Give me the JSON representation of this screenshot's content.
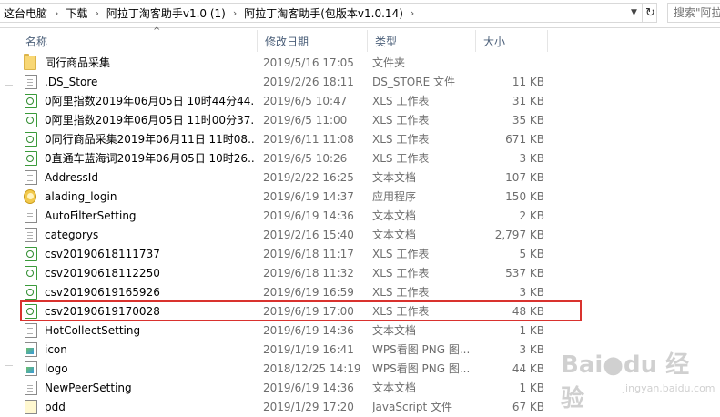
{
  "address": {
    "breadcrumbs": [
      "这台电脑",
      "下载",
      "阿拉丁淘客助手v1.0 (1)",
      "阿拉丁淘客助手(包版本v1.0.14)"
    ],
    "search_placeholder": "搜索\"阿拉丁"
  },
  "columns": {
    "name": "名称",
    "date": "修改日期",
    "type": "类型",
    "size": "大小"
  },
  "files": [
    {
      "name": "同行商品采集",
      "date": "2019/5/16 17:05",
      "type": "文件夹",
      "size": "",
      "icon": "folder-icon"
    },
    {
      "name": ".DS_Store",
      "date": "2019/2/26 18:11",
      "type": "DS_STORE 文件",
      "size": "11 KB",
      "icon": "file-icon"
    },
    {
      "name": "0阿里指数2019年06月05日 10时44分44...",
      "date": "2019/6/5 10:47",
      "type": "XLS 工作表",
      "size": "31 KB",
      "icon": "xls-icon"
    },
    {
      "name": "0阿里指数2019年06月05日 11时00分37...",
      "date": "2019/6/5 11:00",
      "type": "XLS 工作表",
      "size": "35 KB",
      "icon": "xls-icon"
    },
    {
      "name": "0同行商品采集2019年06月11日 11时08...",
      "date": "2019/6/11 11:08",
      "type": "XLS 工作表",
      "size": "671 KB",
      "icon": "xls-icon"
    },
    {
      "name": "0直通车蓝海词2019年06月05日 10时26...",
      "date": "2019/6/5 10:26",
      "type": "XLS 工作表",
      "size": "3 KB",
      "icon": "xls-icon"
    },
    {
      "name": "AddressId",
      "date": "2019/2/22 16:25",
      "type": "文本文档",
      "size": "107 KB",
      "icon": "text-file-icon"
    },
    {
      "name": "alading_login",
      "date": "2019/6/19 14:37",
      "type": "应用程序",
      "size": "150 KB",
      "icon": "app-icon"
    },
    {
      "name": "AutoFilterSetting",
      "date": "2019/6/19 14:36",
      "type": "文本文档",
      "size": "2 KB",
      "icon": "text-file-icon"
    },
    {
      "name": "categorys",
      "date": "2019/2/16 15:40",
      "type": "文本文档",
      "size": "2,797 KB",
      "icon": "text-file-icon"
    },
    {
      "name": "csv20190618111737",
      "date": "2019/6/18 11:17",
      "type": "XLS 工作表",
      "size": "5 KB",
      "icon": "xls-icon"
    },
    {
      "name": "csv20190618112250",
      "date": "2019/6/18 11:32",
      "type": "XLS 工作表",
      "size": "537 KB",
      "icon": "xls-icon"
    },
    {
      "name": "csv20190619165926",
      "date": "2019/6/19 16:59",
      "type": "XLS 工作表",
      "size": "3 KB",
      "icon": "xls-icon"
    },
    {
      "name": "csv20190619170028",
      "date": "2019/6/19 17:00",
      "type": "XLS 工作表",
      "size": "48 KB",
      "icon": "xls-icon"
    },
    {
      "name": "HotCollectSetting",
      "date": "2019/6/19 14:36",
      "type": "文本文档",
      "size": "1 KB",
      "icon": "text-file-icon"
    },
    {
      "name": "icon",
      "date": "2019/1/19 16:41",
      "type": "WPS看图 PNG 图...",
      "size": "3 KB",
      "icon": "png-icon"
    },
    {
      "name": "logo",
      "date": "2018/12/25 14:19",
      "type": "WPS看图 PNG 图...",
      "size": "44 KB",
      "icon": "png-icon"
    },
    {
      "name": "NewPeerSetting",
      "date": "2019/6/19 14:36",
      "type": "文本文档",
      "size": "1 KB",
      "icon": "text-file-icon"
    },
    {
      "name": "pdd",
      "date": "2019/1/29 17:20",
      "type": "JavaScript 文件",
      "size": "67 KB",
      "icon": "js-icon"
    }
  ],
  "watermark": {
    "logo": "Bai●du 经验",
    "url": "jingyan.baidu.com"
  }
}
